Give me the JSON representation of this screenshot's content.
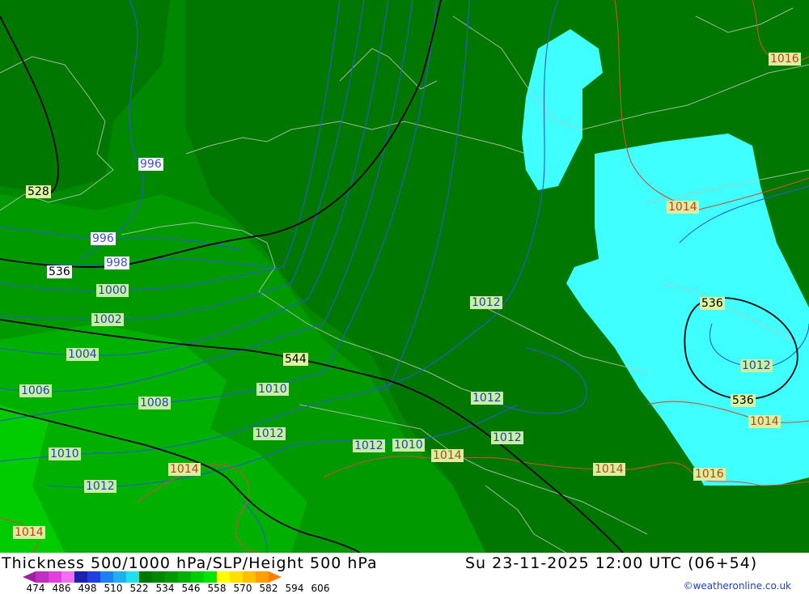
{
  "header": {
    "title": "Thickness 500/1000 hPa/SLP/Height 500 hPa",
    "valid": "Su 23-11-2025 12:00 UTC (06+54)",
    "credit": "©weatheronline.co.uk"
  },
  "legend": {
    "ticks": [
      "474",
      "486",
      "498",
      "510",
      "522",
      "534",
      "546",
      "558",
      "570",
      "582",
      "594",
      "606"
    ],
    "colors": [
      "#a020a0",
      "#c030c0",
      "#e040e0",
      "#f070f0",
      "#2020b0",
      "#2040e0",
      "#2080f0",
      "#20b0f0",
      "#20e0f0",
      "#007800",
      "#008800",
      "#009800",
      "#00b000",
      "#00cc00",
      "#00e600",
      "#ffff00",
      "#ffe000",
      "#ffc000",
      "#ffa000",
      "#ff8000"
    ]
  },
  "map_labels": {
    "h528": "528",
    "h536a": "536",
    "h536b": "536",
    "h536c": "536",
    "h544": "544",
    "p996a": "996",
    "p996b": "996",
    "p998": "998",
    "p1000": "1000",
    "p1002": "1002",
    "p1004": "1004",
    "p1006": "1006",
    "p1008": "1008",
    "p1010a": "1010",
    "p1010b": "1010",
    "p1010c": "1010",
    "p1012a": "1012",
    "p1012b": "1012",
    "p1012c": "1012",
    "p1012d": "1012",
    "p1012e": "1012",
    "p1012f": "1012",
    "p1012g": "1012",
    "p1014a": "1014",
    "p1014b": "1014",
    "p1014c": "1014",
    "p1014d": "1014",
    "p1014e": "1014",
    "p1016a": "1016",
    "p1016b": "1016"
  }
}
